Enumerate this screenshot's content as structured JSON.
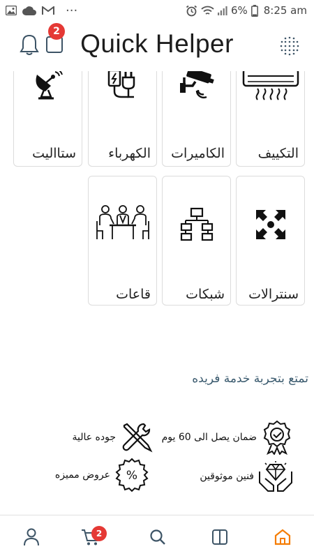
{
  "status_bar": {
    "icons_left": [
      "gallery-icon",
      "cloud-icon",
      "gmail-icon",
      "more-dots-icon"
    ],
    "dots": "···",
    "icons_right": [
      "alarm-icon",
      "wifi-icon",
      "signal-icon",
      "battery-icon"
    ],
    "battery": "6%",
    "time": "8:25 am"
  },
  "header": {
    "title": "Quick Helper",
    "notification_badge": "2",
    "icons": [
      "bell-icon",
      "square-icon",
      "dot-grid-icon"
    ]
  },
  "services": [
    {
      "label": "التكييف",
      "icon": "air-conditioner-icon"
    },
    {
      "label": "الكاميرات",
      "icon": "security-camera-icon"
    },
    {
      "label": "الكهرباء",
      "icon": "electric-plug-icon"
    },
    {
      "label": "ستااليت",
      "icon": "satellite-dish-icon"
    },
    {
      "label": "سنترالات",
      "icon": "converging-arrows-icon"
    },
    {
      "label": "شبكات",
      "icon": "network-icon"
    },
    {
      "label": "قاعات",
      "icon": "meeting-room-icon"
    }
  ],
  "section": {
    "title": "تمتع بتجربة خدمة فريده",
    "features": [
      {
        "text": "ضمان يصل الى 60 يوم",
        "icon": "guarantee-badge-icon"
      },
      {
        "text": "جوده عالية",
        "icon": "tools-icon"
      },
      {
        "text": "فنين موثوقين",
        "icon": "diamond-hands-icon"
      },
      {
        "text": "عروض مميزه",
        "icon": "discount-badge-icon"
      }
    ]
  },
  "bottom_nav": {
    "items": [
      "profile-icon",
      "cart-icon",
      "search-icon",
      "layout-icon",
      "home-icon"
    ],
    "cart_badge": "2",
    "active": "home-icon",
    "accent": "#f57c00",
    "icon_color": "#3d5466"
  },
  "colors": {
    "badge": "#e53935",
    "card_border": "#dcdcdc",
    "section_title": "#3a5a6e"
  }
}
